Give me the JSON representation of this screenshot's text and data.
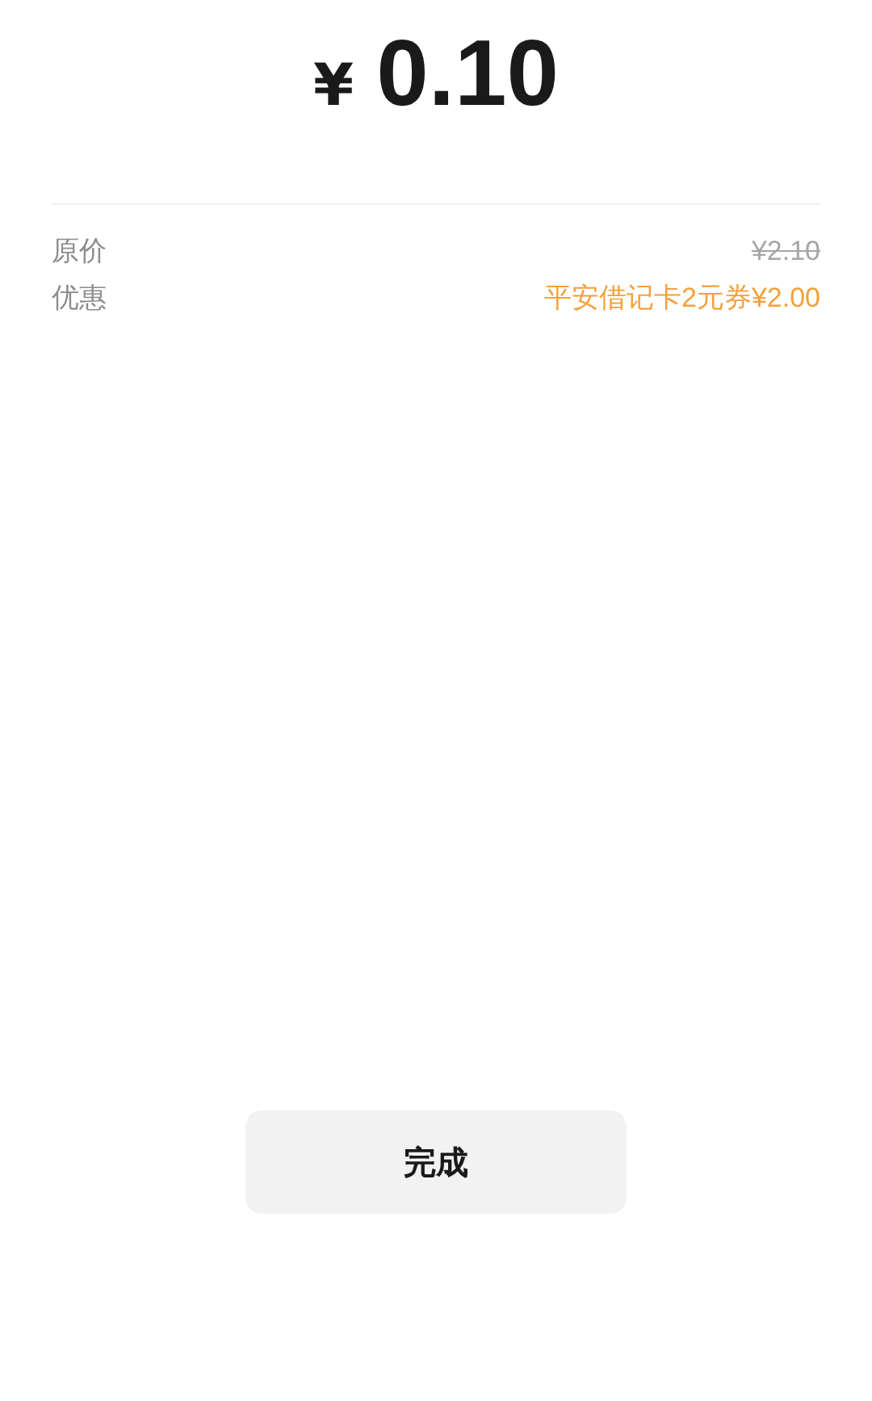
{
  "amount": {
    "currency": "¥",
    "value": "0.10"
  },
  "details": [
    {
      "label": "原价",
      "value": "¥2.10",
      "kind": "struck"
    },
    {
      "label": "优惠",
      "value": "平安借记卡2元券¥2.00",
      "kind": "discount"
    }
  ],
  "done_button": "完成"
}
